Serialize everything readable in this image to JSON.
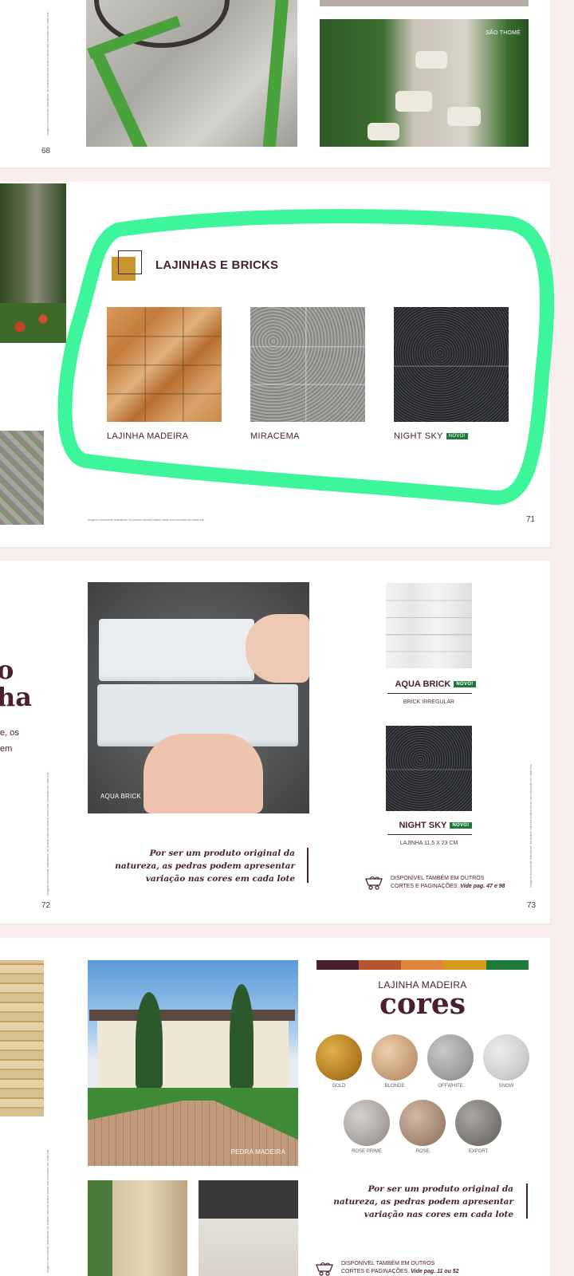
{
  "page68": {
    "page_number": "68",
    "photo_caption": "SÃO THOMÉ",
    "side_note": "Imagens meramente ilustrativas. As pedras naturais podem variar sua coloração em cada lote."
  },
  "page71": {
    "page_number": "71",
    "section_title": "LAJINHAS E BRICKS",
    "footnote": "Imagens meramente ilustrativas. As pedras naturais podem variar sua coloração em cada lote.",
    "products": [
      {
        "name": "LAJINHA MADEIRA",
        "badge": ""
      },
      {
        "name": "MIRACEMA",
        "badge": ""
      },
      {
        "name": "NIGHT SKY",
        "badge": "NOVO!"
      }
    ]
  },
  "page72": {
    "page_number": "72",
    "partial_title_1": "o",
    "partial_title_2": "ha",
    "partial_text_1": "e, os",
    "partial_text_2": "em",
    "photo_caption": "AQUA BRICK",
    "quote_line1": "Por ser um produto original da",
    "quote_line2": "natureza, as pedras podem apresentar",
    "quote_line3": "variação nas cores em cada lote",
    "side_note": "Imagens meramente ilustrativas. As pedras naturais podem variar sua coloração em cada lote."
  },
  "page73": {
    "page_number": "73",
    "product1_name": "AQUA BRICK",
    "product1_badge": "NOVO!",
    "product1_sub": "BRICK IRREGULAR",
    "product2_name": "NIGHT SKY",
    "product2_badge": "NOVO!",
    "product2_sub": "LAJINHA 11,5 X 23 CM",
    "also_line1": "DISPONÍVEL TAMBÉM EM OUTROS",
    "also_line2": "CORTES E PAGINAÇÕES.",
    "also_ref": "Vide pag. 47 e 98",
    "side_note": "Imagens meramente ilustrativas. As pedras naturais podem variar sua coloração em cada lote."
  },
  "page74": {
    "photo_caption": "PEDRA MADEIRA",
    "side_note": "Imagens meramente ilustrativas. As pedras naturais podem variar sua coloração em cada lote.",
    "color_bar": [
      "#4a2030",
      "#b8552e",
      "#e0853a",
      "#d39a1a",
      "#1e7a3a"
    ],
    "heading_small": "LAJINHA MADEIRA",
    "heading_big": "cores",
    "swatches": [
      {
        "label": "GOLD",
        "color": "#c8952e"
      },
      {
        "label": "BLONDE",
        "color": "#d4b08a"
      },
      {
        "label": "OFFWHITE",
        "color": "#b0b0b2"
      },
      {
        "label": "SNOW",
        "color": "#d8d8d6"
      },
      {
        "label": "ROSE PRIME",
        "color": "#b8b4b0"
      },
      {
        "label": "ROSE",
        "color": "#b89a88"
      },
      {
        "label": "EXPORT",
        "color": "#8a8480"
      }
    ],
    "quote_line1": "Por ser um produto original da",
    "quote_line2": "natureza, as pedras podem apresentar",
    "quote_line3": "variação nas cores em cada lote",
    "also_line1": "DISPONÍVEL TAMBÉM EM OUTROS",
    "also_line2": "CORTES E PAGINAÇÕES.",
    "also_ref": "Vide pag. 11 ou 52"
  },
  "annotation": {
    "color": "#3df59a"
  }
}
